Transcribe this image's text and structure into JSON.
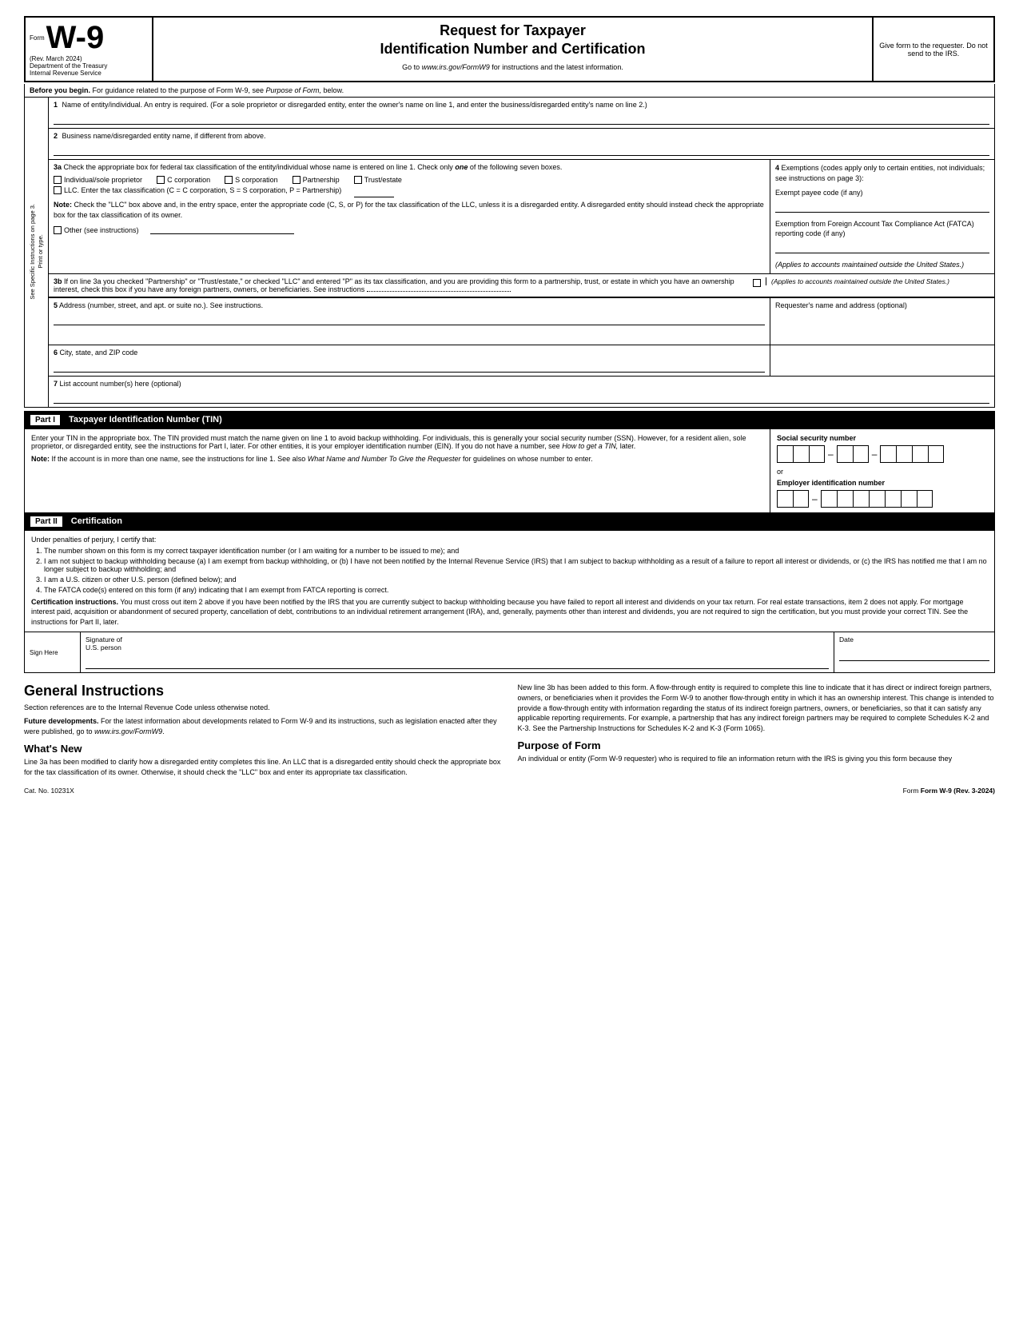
{
  "header": {
    "form_label": "Form",
    "form_number": "W-9",
    "rev_date": "(Rev. March 2024)",
    "dept1": "Department of the Treasury",
    "dept2": "Internal Revenue Service",
    "title1": "Request for Taxpayer",
    "title2": "Identification Number and Certification",
    "go_to": "Go to",
    "website": "www.irs.gov/FormW9",
    "go_to_suffix": "for instructions and the latest information.",
    "give_form": "Give form to the requester. Do not send to the IRS."
  },
  "before_begin": {
    "label": "Before you begin.",
    "text": "For guidance related to the purpose of Form W-9, see",
    "italic": "Purpose of Form,",
    "text2": "below."
  },
  "lines": {
    "line1_num": "1",
    "line1_label": "Name of entity/individual. An entry is required. (For a sole proprietor or disregarded entity, enter the owner's name on line 1, and enter the business/disregarded entity's name on line 2.)",
    "line2_num": "2",
    "line2_label": "Business name/disregarded entity name, if different from above.",
    "line3a_num": "3a",
    "line3a_intro": "Check the appropriate box for federal tax classification of the entity/individual whose name is entered on line 1. Check only",
    "line3a_one": "one",
    "line3a_suffix": "of the following seven boxes.",
    "cb_individual": "Individual/sole proprietor",
    "cb_c_corp": "C corporation",
    "cb_s_corp": "S corporation",
    "cb_partnership": "Partnership",
    "cb_trust": "Trust/estate",
    "cb_llc": "LLC. Enter the tax classification (C = C corporation, S = S corporation, P = Partnership)",
    "note_label": "Note:",
    "note_text": "Check the \"LLC\" box above and, in the entry space, enter the appropriate code (C, S, or P) for the tax classification of the LLC, unless it is a disregarded entity. A disregarded entity should instead check the appropriate box for the tax classification of its owner.",
    "cb_other": "Other (see instructions)",
    "line3b_num": "3b",
    "line3b_text": "If on line 3a you checked \"Partnership\" or \"Trust/estate,\" or checked \"LLC\" and entered \"P\" as its tax classification, and you are providing this form to a partnership, trust, or estate in which you have an ownership interest, check this box if you have any foreign partners, owners, or beneficiaries. See instructions",
    "line4_num": "4",
    "line4_label": "Exemptions (codes apply only to certain entities, not individuals; see instructions on page 3):",
    "exempt_payee": "Exempt payee code (if any)",
    "fatca_label": "Exemption from Foreign Account Tax Compliance Act (FATCA) reporting code (if any)",
    "applies_label": "(Applies to accounts maintained outside the United States.)",
    "line5_num": "5",
    "line5_label": "Address (number, street, and apt. or suite no.). See instructions.",
    "line5_right": "Requester's name and address (optional)",
    "line6_num": "6",
    "line6_label": "City, state, and ZIP code",
    "line7_num": "7",
    "line7_label": "List account number(s) here (optional)"
  },
  "part1": {
    "label": "Part I",
    "title": "Taxpayer Identification Number (TIN)",
    "intro": "Enter your TIN in the appropriate box. The TIN provided must match the name given on line 1 to avoid backup withholding. For individuals, this is generally your social security number (SSN). However, for a resident alien, sole proprietor, or disregarded entity, see the instructions for Part I, later. For other entities, it is your employer identification number (EIN). If you do not have a number, see",
    "how_to_get": "How to get a TIN,",
    "intro_suffix": "later.",
    "note_label": "Note:",
    "note_text": "If the account is in more than one name, see the instructions for line 1. See also",
    "what_name": "What Name and Number To Give the Requester",
    "note_suffix": "for guidelines on whose number to enter.",
    "ssn_label": "Social security number",
    "or_label": "or",
    "ein_label": "Employer identification number"
  },
  "part2": {
    "label": "Part II",
    "title": "Certification",
    "under_penalties": "Under penalties of perjury, I certify that:",
    "items": [
      "The number shown on this form is my correct taxpayer identification number (or I am waiting for a number to be issued to me); and",
      "I am not subject to backup withholding because (a) I am exempt from backup withholding, or (b) I have not been notified by the Internal Revenue Service (IRS) that I am subject to backup withholding as a result of a failure to report all interest or dividends, or (c) the IRS has notified me that I am no longer subject to backup withholding; and",
      "I am a U.S. citizen or other U.S. person (defined below); and",
      "The FATCA code(s) entered on this form (if any) indicating that I am exempt from FATCA reporting is correct."
    ],
    "cert_instructions_bold": "Certification instructions.",
    "cert_instructions_text": "You must cross out item 2 above if you have been notified by the IRS that you are currently subject to backup withholding because you have failed to report all interest and dividends on your tax return. For real estate transactions, item 2 does not apply. For mortgage interest paid, acquisition or abandonment of secured property, cancellation of debt, contributions to an individual retirement arrangement (IRA), and, generally, payments other than interest and dividends, you are not required to sign the certification, but you must provide your correct TIN. See the instructions for Part II, later."
  },
  "sign_here": {
    "label": "Sign Here",
    "sig_label": "Signature of",
    "sig_sublabel": "U.S. person",
    "date_label": "Date"
  },
  "general_instructions": {
    "title": "General Instructions",
    "section_refs": "Section references are to the Internal Revenue Code unless otherwise noted.",
    "future_label": "Future developments.",
    "future_text": "For the latest information about developments related to Form W-9 and its instructions, such as legislation enacted after they were published, go to",
    "future_website": "www.irs.gov/FormW9",
    "whats_new_title": "What's New",
    "whats_new_text": "Line 3a has been modified to clarify how a disregarded entity completes this line. An LLC that is a disregarded entity should check the appropriate box for the tax classification of its owner. Otherwise, it should check the \"LLC\" box and enter its appropriate tax classification.",
    "new_3b_text": "New line 3b has been added to this form. A flow-through entity is required to complete this line to indicate that it has direct or indirect foreign partners, owners, or beneficiaries when it provides the Form W-9 to another flow-through entity in which it has an ownership interest. This change is intended to provide a flow-through entity with information regarding the status of its indirect foreign partners, owners, or beneficiaries, so that it can satisfy any applicable reporting requirements. For example, a partnership that has any indirect foreign partners may be required to complete Schedules K-2 and K-3. See the Partnership Instructions for Schedules K-2 and K-3 (Form 1065).",
    "purpose_title": "Purpose of Form",
    "purpose_text": "An individual or entity (Form W-9 requester) who is required to file an information return with the IRS is giving you this form because they"
  },
  "footer": {
    "cat_no": "Cat. No. 10231X",
    "form_label": "Form W-9 (Rev. 3-2024)"
  },
  "side_label": {
    "print": "Print or type.",
    "specific": "See Specific Instructions on page 3."
  }
}
